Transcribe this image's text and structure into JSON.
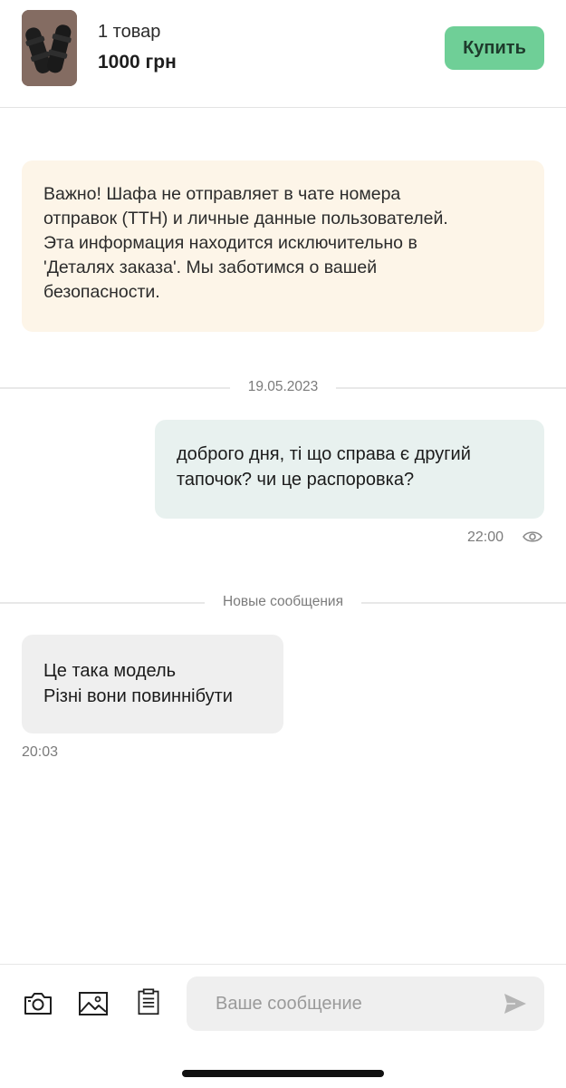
{
  "header": {
    "item_count": "1 товар",
    "price": "1000 грн",
    "buy_label": "Купить",
    "buy_color": "#6fcf97"
  },
  "notice": {
    "lines": [
      "Важно! Шафа не отправляет в чате номера",
      "отправок (ТТН) и личные данные пользователей.",
      "Эта информация находится исключительно в",
      "'Деталях заказа'. Мы заботимся о вашей",
      "безопасности."
    ]
  },
  "chat": {
    "date_divider": "19.05.2023",
    "outgoing": {
      "lines": [
        "доброго дня, ті що справа є другий",
        "тапочок? чи це распоровка?"
      ],
      "time": "22:00",
      "status_icon": "eye-icon"
    },
    "new_messages_divider": "Новые сообщения",
    "incoming": {
      "lines": [
        "Це така модель",
        "Різні вони повиннібути"
      ],
      "time": "20:03"
    }
  },
  "composer": {
    "placeholder": "Ваше сообщение",
    "icons": [
      "camera-icon",
      "image-icon",
      "clipboard-icon",
      "send-icon"
    ]
  }
}
